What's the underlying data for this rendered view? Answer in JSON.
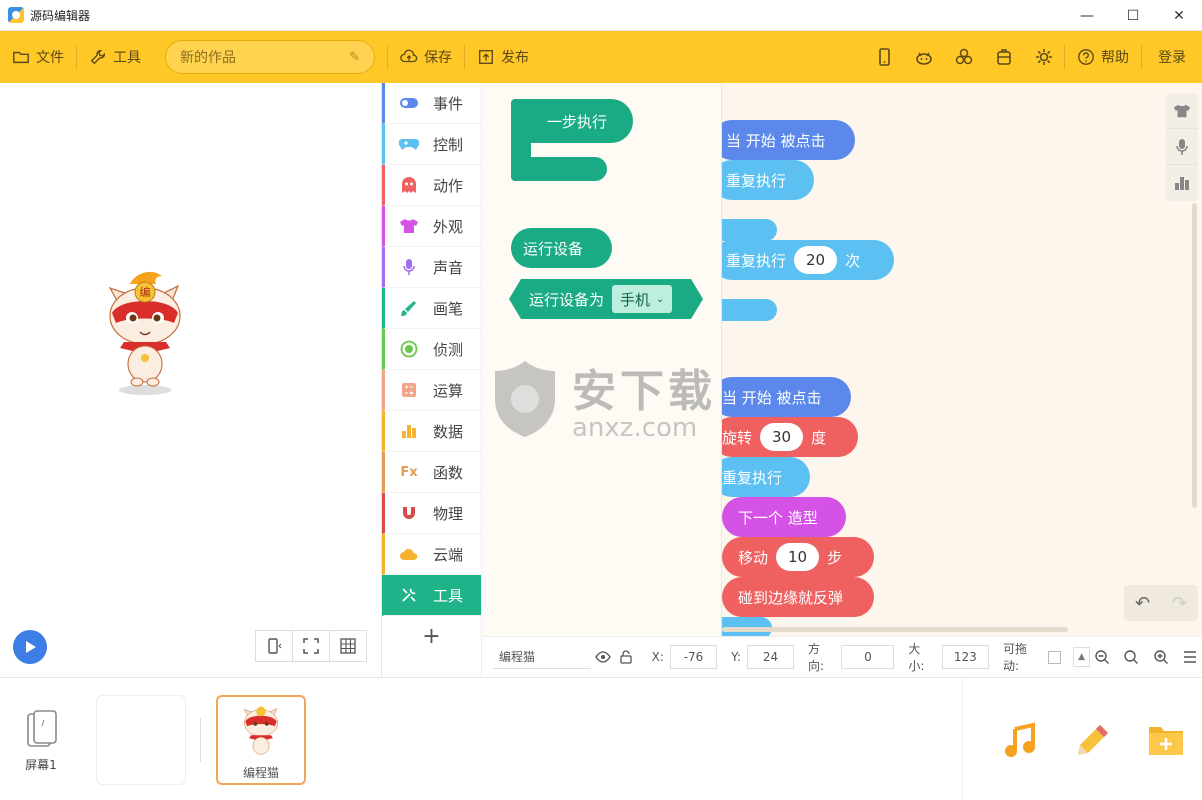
{
  "window": {
    "title": "源码编辑器",
    "min": "—",
    "max": "☐",
    "close": "✕"
  },
  "toolbar": {
    "file": "文件",
    "tools": "工具",
    "project_name": "新的作品",
    "save": "保存",
    "publish": "发布",
    "help": "帮助",
    "login": "登录"
  },
  "categories": [
    {
      "label": "事件",
      "color": "#5b88ea",
      "icon": "toggle-icon"
    },
    {
      "label": "控制",
      "color": "#5cc0f2",
      "icon": "gamepad-icon"
    },
    {
      "label": "动作",
      "color": "#ef6060",
      "icon": "ghost-icon"
    },
    {
      "label": "外观",
      "color": "#d452e5",
      "icon": "shirt-icon"
    },
    {
      "label": "声音",
      "color": "#a36ef0",
      "icon": "mic-icon"
    },
    {
      "label": "画笔",
      "color": "#22b58c",
      "icon": "brush-icon"
    },
    {
      "label": "侦测",
      "color": "#6bc84a",
      "icon": "target-icon"
    },
    {
      "label": "运算",
      "color": "#f2a488",
      "icon": "calc-icon"
    },
    {
      "label": "数据",
      "color": "#f6b12e",
      "icon": "bars-icon"
    },
    {
      "label": "函数",
      "color": "#e89a55",
      "icon": "fx-icon"
    },
    {
      "label": "物理",
      "color": "#d74b4b",
      "icon": "magnet-icon"
    },
    {
      "label": "云端",
      "color": "#f6b12e",
      "icon": "cloud-icon"
    },
    {
      "label": "工具",
      "color": "#20b389",
      "icon": "wrench-icon"
    }
  ],
  "palette": {
    "step_block": "一步执行",
    "run_device": "运行设备",
    "run_device_as": "运行设备为",
    "device_value": "手机"
  },
  "code": {
    "when_start_1": "当 开始 被点击",
    "repeat_1": "重复执行",
    "repeat_n": "重复执行",
    "repeat_n_value": "20",
    "repeat_n_unit": "次",
    "when_start_2": "当 开始 被点击",
    "rotate": "旋转",
    "rotate_value": "30",
    "rotate_unit": "度",
    "repeat_2": "重复执行",
    "next_costume": "下一个 造型",
    "move": "移动",
    "move_value": "10",
    "move_unit": "步",
    "bounce": "碰到边缘就反弹"
  },
  "watermark": {
    "cn": "安下载",
    "en": "anxz.com"
  },
  "props": {
    "sprite_name": "编程猫",
    "x_label": "X:",
    "x": "-76",
    "y_label": "Y:",
    "y": "24",
    "dir_label": "方向:",
    "dir": "0",
    "size_label": "大小:",
    "size": "123",
    "drag_label": "可拖动:"
  },
  "bottom": {
    "screen_label": "屏幕1",
    "sprite_label": "编程猫"
  },
  "sprite_badge": "编"
}
